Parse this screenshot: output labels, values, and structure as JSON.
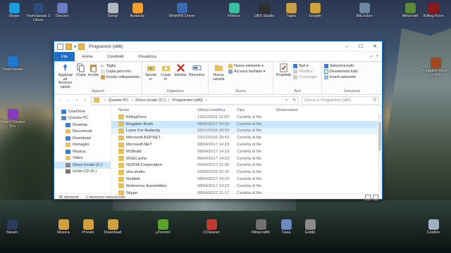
{
  "desktop": {
    "icons_top": [
      {
        "label": "Skype",
        "color": "#1a9ee0"
      },
      {
        "label": "TeamSpeak 3 Client",
        "color": "#2f4b7a"
      },
      {
        "label": "Discord",
        "color": "#6b7cc7"
      },
      {
        "label": "Songr",
        "color": "#b0b8c0"
      },
      {
        "label": "Audacity",
        "color": "#f0a030"
      },
      {
        "label": "WinRAR Driver",
        "color": "#3a6ab0"
      },
      {
        "label": "Filmora",
        "color": "#3ac0a0"
      },
      {
        "label": "OBS Studio",
        "color": "#303030"
      },
      {
        "label": "Tagra",
        "color": "#c7a04a"
      },
      {
        "label": "Sceglie",
        "color": "#d0a040"
      },
      {
        "label": "BitLocker",
        "color": "#6a8aa0"
      },
      {
        "label": "Minecraft",
        "color": "#5a8a3a"
      },
      {
        "label": "Killing Floor",
        "color": "#8a1a1a"
      }
    ],
    "icons_left": [
      {
        "label": "TeamViewer",
        "color": "#1e78d2"
      },
      {
        "label": "Twitch Creator Pro",
        "color": "#8a3ac0"
      }
    ],
    "icons_right": [
      {
        "label": "Kingdom Rush 2 HD",
        "color": "#a04a20"
      }
    ],
    "icons_bottom": [
      {
        "label": "Steam",
        "color": "#2a3a5a"
      },
      {
        "label": "Musica",
        "color": "#d0a040"
      },
      {
        "label": "Privato",
        "color": "#d0a040"
      },
      {
        "label": "Download",
        "color": "#d0a040"
      },
      {
        "label": "µTorrent",
        "color": "#5aa030"
      },
      {
        "label": "CCleaner",
        "color": "#c03a30"
      },
      {
        "label": "MinecraftIt",
        "color": "#707070"
      },
      {
        "label": "Casa",
        "color": "#6a8ac0"
      },
      {
        "label": "Gobbi",
        "color": "#8a8a8a"
      },
      {
        "label": "Cestino",
        "color": "#a0b0c0"
      }
    ]
  },
  "window": {
    "title": "Programmi (x86)",
    "controls": {
      "minimize": "–",
      "maximize": "☐",
      "close": "✕"
    },
    "menu": {
      "file": "File",
      "home": "Home",
      "share": "Condividi",
      "view": "Visualizza"
    },
    "ribbon": {
      "pin": "Aggiungi ad Accesso rapido",
      "copy": "Copia",
      "paste": "Incolla",
      "cut": "Taglia",
      "copy_path": "Copia percorso",
      "paste_shortcut": "Incolla collegamento",
      "clipboard_group": "Appunti",
      "move_to": "Sposta in",
      "copy_to": "Copia in",
      "delete": "Elimina",
      "rename": "Rinomina",
      "organize_group": "Organizza",
      "new_folder": "Nuova cartella",
      "new_item": "Nuovo elemento ▾",
      "easy_access": "Accesso facilitato ▾",
      "new_group": "Nuovo",
      "properties": "Proprietà",
      "open": "Apri ▾",
      "edit": "Modifica",
      "history": "Cronologia",
      "open_group": "Apri",
      "select_all": "Seleziona tutto",
      "select_none": "Deseleziona tutto",
      "invert_selection": "Inverti selezione",
      "select_group": "Seleziona"
    },
    "address": {
      "crumbs": [
        "Questo PC",
        "Disco locale (C:)",
        "Programmi (x86)"
      ],
      "search_placeholder": "Cerca in Programmi (x86)"
    },
    "nav": [
      {
        "label": "OneDrive",
        "indent": false
      },
      {
        "label": "Questo PC",
        "indent": false
      },
      {
        "label": "Desktop",
        "indent": true
      },
      {
        "label": "Documenti",
        "indent": true
      },
      {
        "label": "Download",
        "indent": true
      },
      {
        "label": "Immagini",
        "indent": true
      },
      {
        "label": "Musica",
        "indent": true
      },
      {
        "label": "Video",
        "indent": true
      },
      {
        "label": "Disco locale (C:)",
        "indent": true,
        "selected": true
      },
      {
        "label": "Unità CD (E:)",
        "indent": true
      }
    ],
    "columns": {
      "name": "Nome",
      "date": "Ultima modifica",
      "type": "Tipo",
      "size": "Dimensione"
    },
    "files": [
      {
        "name": "KillingFloor",
        "date": "13/11/2016 12:50",
        "type": "Cartella di file"
      },
      {
        "name": "Kingdom Rush",
        "date": "08/05/2017 20:20",
        "type": "Cartella di file",
        "selected": true
      },
      {
        "name": "Lame For Audacity",
        "date": "23/12/2015 20:59",
        "type": "Cartella di file"
      },
      {
        "name": "Microsoft ASP.NET",
        "date": "23/12/2015 20:43",
        "type": "Cartella di file"
      },
      {
        "name": "Microsoft.NET",
        "date": "08/04/2017 14:23",
        "type": "Cartella di file"
      },
      {
        "name": "MSBuild",
        "date": "08/04/2017 14:23",
        "type": "Cartella di file"
      },
      {
        "name": "MSECache",
        "date": "08/04/2017 14:23",
        "type": "Cartella di file"
      },
      {
        "name": "NVIDIA Corporation",
        "date": "05/04/2017 21:00",
        "type": "Cartella di file"
      },
      {
        "name": "obs-studio",
        "date": "03/09/2016 22:16",
        "type": "Cartella di file"
      },
      {
        "name": "Realtek",
        "date": "08/04/2017 14:23",
        "type": "Cartella di file"
      },
      {
        "name": "Reference Assemblies",
        "date": "08/04/2017 14:23",
        "type": "Cartella di file"
      },
      {
        "name": "Skype",
        "date": "08/04/2017 21:17",
        "type": "Cartella di file"
      }
    ],
    "status": {
      "count": "38 elementi",
      "selected": "1 elemento selezionato"
    }
  }
}
